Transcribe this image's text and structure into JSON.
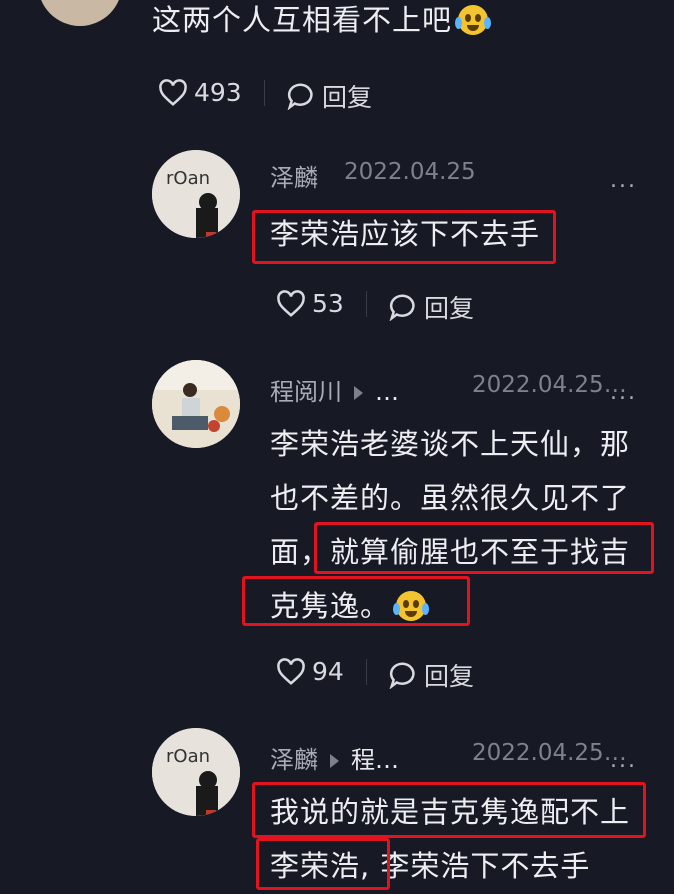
{
  "top_comment": {
    "text": "这两个人互相看不上吧",
    "likes": "493",
    "reply_label": "回复"
  },
  "replies": [
    {
      "user": "泽麟",
      "date": "2022.04.25",
      "text": "李荣浩应该下不去手",
      "likes": "53",
      "reply_label": "回复",
      "more": "..."
    },
    {
      "user": "程阅川",
      "reply_to": "…",
      "date": "2022.04.25…",
      "text_line1": "李荣浩老婆谈不上天仙，那",
      "text_line2": "也不差的。虽然很久见不了",
      "text_line3a": "面，",
      "text_line3b": "就算偷腥也不至于找吉",
      "text_line4": "克隽逸。",
      "likes": "94",
      "reply_label": "回复",
      "more": "..."
    },
    {
      "user": "泽麟",
      "reply_to": "程…",
      "date": "2022.04.25…",
      "text_line1": "我说的就是吉克隽逸配不上",
      "text_line2a": "李荣浩,",
      "text_line2b": " 李荣浩下不去手",
      "more": "..."
    }
  ],
  "icons": {
    "like": "heart-icon",
    "reply": "comment-bubble-icon",
    "emoji": "crying-laughing-emoji-icon",
    "arrow": "reply-arrow-icon"
  },
  "colors": {
    "background": "#171a24",
    "highlight": "#e0131f"
  }
}
